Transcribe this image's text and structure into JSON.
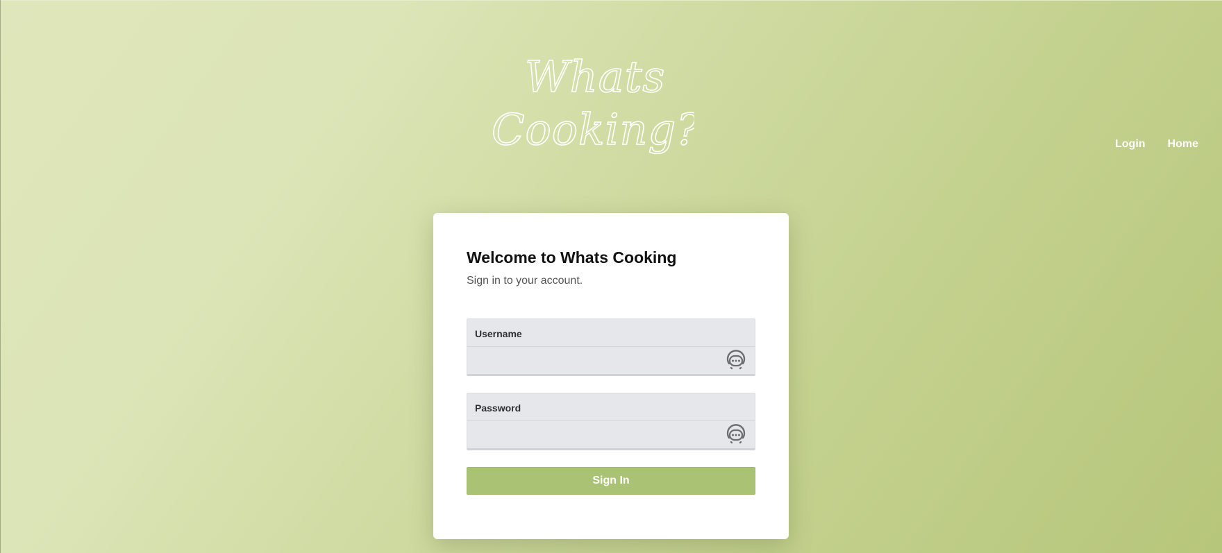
{
  "logo": {
    "line1": "Whats",
    "line2": "Cooking??"
  },
  "nav": {
    "items": [
      {
        "label": "Login"
      },
      {
        "label": "Home"
      }
    ]
  },
  "card": {
    "title": "Welcome to Whats Cooking",
    "subtitle": "Sign in to your account.",
    "fields": [
      {
        "label": "Username",
        "value": "",
        "icon": "password-manager-icon"
      },
      {
        "label": "Password",
        "value": "",
        "icon": "password-manager-icon"
      }
    ],
    "submit_label": "Sign In"
  },
  "colors": {
    "background_start": "#dfe6bb",
    "background_end": "#b6c67a",
    "button": "#aac274",
    "card": "#ffffff",
    "field": "#e6e7ea"
  }
}
